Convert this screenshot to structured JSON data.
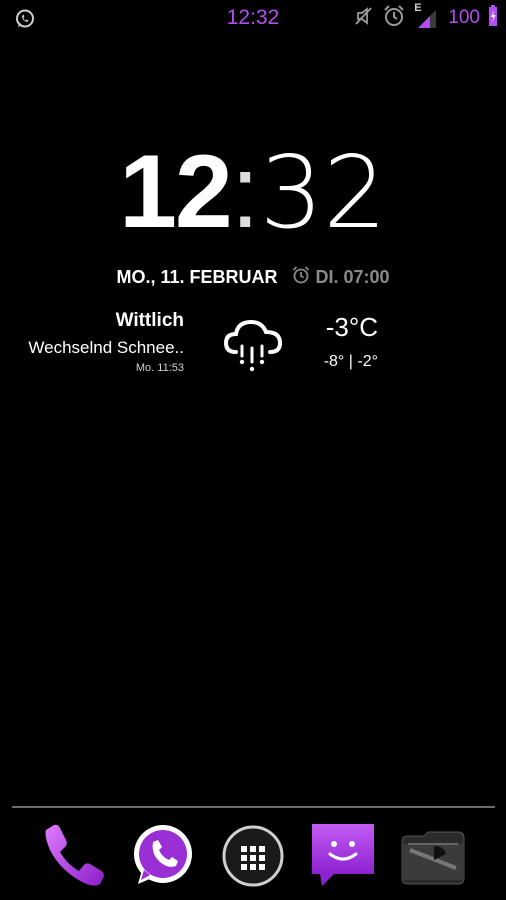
{
  "status_bar": {
    "time": "12:32",
    "battery_text": "100",
    "network_type": "E",
    "accent_color": "#b24df0",
    "icons": [
      "whatsapp-icon",
      "mute-icon",
      "alarm-icon",
      "signal-icon",
      "battery-charging-icon"
    ]
  },
  "clock": {
    "hours": "12",
    "separator": ":",
    "minutes": "32",
    "date": "MO., 11. FEBRUAR",
    "alarm": "DI. 07:00"
  },
  "weather": {
    "location": "Wittlich",
    "condition": "Wechselnd Schnee..",
    "updated": "Mo. 11:53",
    "temperature": "-3°C",
    "range": "-8° | -2°",
    "icon": "snow-cloud-icon"
  },
  "dock": {
    "apps": [
      "phone-icon",
      "whatsapp-icon",
      "app-drawer-icon",
      "messaging-icon",
      "pirate-app-icon"
    ]
  }
}
